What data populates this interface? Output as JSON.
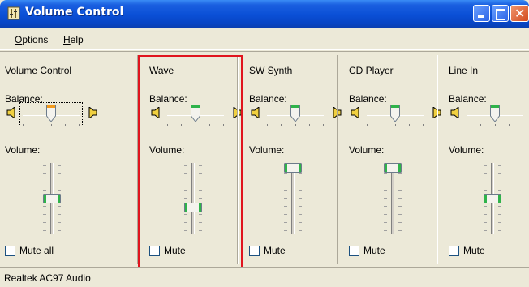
{
  "window": {
    "title": "Volume Control",
    "title_color": "#0a4fd6"
  },
  "menu": {
    "options": "Options",
    "help": "Help"
  },
  "labels": {
    "balance": "Balance:",
    "volume": "Volume:"
  },
  "channels": [
    {
      "name": "Volume Control",
      "mute_label": "Mute all",
      "muted": false,
      "balance": 0.5,
      "volume": 0.5,
      "selected_thumb_color": "#f39a1b"
    },
    {
      "name": "Wave",
      "mute_label": "Mute",
      "muted": false,
      "balance": 0.5,
      "volume": 0.35
    },
    {
      "name": "SW Synth",
      "mute_label": "Mute",
      "muted": false,
      "balance": 0.5,
      "volume": 1.0
    },
    {
      "name": "CD Player",
      "mute_label": "Mute",
      "muted": false,
      "balance": 0.5,
      "volume": 1.0
    },
    {
      "name": "Line In",
      "mute_label": "Mute",
      "muted": false,
      "balance": 0.5,
      "volume": 0.5
    }
  ],
  "status": {
    "device": "Realtek AC97 Audio"
  },
  "colors": {
    "highlight": "#e0141e",
    "thumb_green": "#2fb34a"
  }
}
